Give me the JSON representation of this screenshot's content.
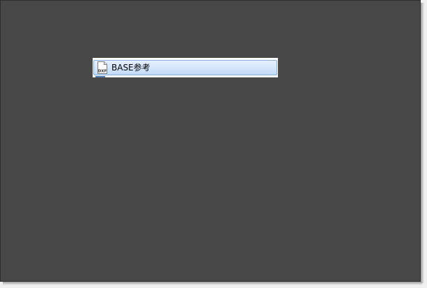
{
  "file_list": {
    "items": [
      {
        "label": "BASE参考",
        "icon": "dxf-file-icon",
        "icon_text": "DXF",
        "selected": true
      }
    ]
  },
  "colors": {
    "background": "#484848",
    "selection_border": "#84acdd",
    "selection_fill": "#d5e6fb"
  }
}
